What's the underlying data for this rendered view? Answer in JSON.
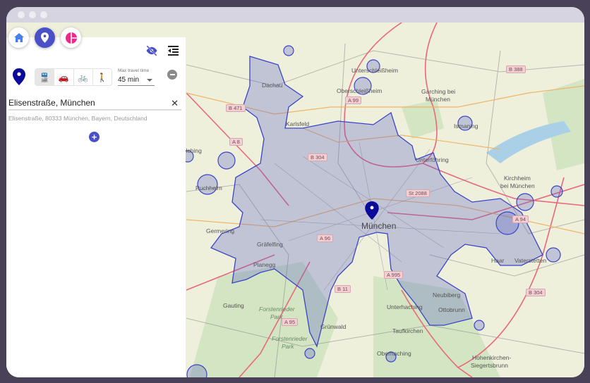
{
  "window": {
    "dots": 3
  },
  "nav": {
    "home": "home",
    "isochrone": "location-pin",
    "stats": "pie-chart"
  },
  "panel": {
    "max_travel_time_label": "Max travel time",
    "max_travel_time_value": "45 min",
    "address_value": "Elisenstraße, München",
    "address_suggestion": "Elisenstraße, 80333 München, Bayern, Deutschland",
    "active_mode": "transit",
    "modes": [
      "transit",
      "car",
      "bike",
      "walk"
    ]
  },
  "map": {
    "isochrone_color": "#3b44c8",
    "marker_color": "#0b0b9a",
    "places": {
      "dachau": "Dachau",
      "unterschleissheim": "Unterschleißheim",
      "oberschleissheim": "Oberschleißheim",
      "garching": "Garching bei",
      "garching2": "München",
      "ismaning": "Ismaning",
      "karlsfeld": "Karlsfeld",
      "unterfoehring": "Unterföhring",
      "kirchheim": "Kirchheim",
      "kirchheim2": "bei München",
      "olching": "Olching",
      "puchheim": "Puchheim",
      "muenchen": "München",
      "groebenzell": "Germering",
      "graefelfing": "Gräfelfing",
      "planegg": "Planegg",
      "gauting": "Gauting",
      "forst1": "Forstenrieder",
      "forst1b": "Park",
      "forst2": "Forstenrieder",
      "forst2b": "Park",
      "gruenwald": "Grünwald",
      "unterhaching": "Unterhaching",
      "taufkirchen": "Taufkirchen",
      "oberhaching": "Oberhaching",
      "neubiberg": "Neubiberg",
      "ottobrunn": "Ottobrunn",
      "haar": "Haar",
      "vaterstetten": "Vaterstetten",
      "hohenkirchen": "Hohenkirchen-",
      "hohenkirchen2": "Siegertsbrunn"
    },
    "roads": {
      "b388": "B 388",
      "b471": "B 471",
      "a8": "A 8",
      "a99": "A 99",
      "b304a": "B 304",
      "st2088": "St 2088",
      "a96": "A 96",
      "a94": "A 94",
      "a995": "A 995",
      "b11": "B 11",
      "a95": "A 95",
      "b304": "B 304"
    }
  }
}
